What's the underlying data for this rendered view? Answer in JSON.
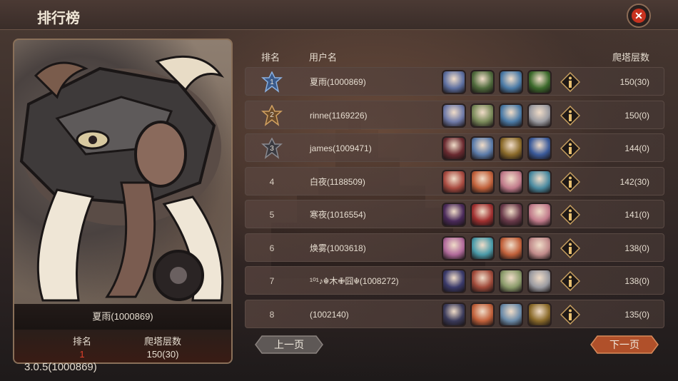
{
  "header": {
    "title": "排行榜"
  },
  "selected": {
    "name": "夏雨(1000869)",
    "rank_label": "排名",
    "rank_value": "1",
    "floor_label": "爬塔层数",
    "floor_value": "150(30)"
  },
  "version": "3.0.5(1000869)",
  "table": {
    "headers": {
      "rank": "排名",
      "user": "用户名",
      "floor": "爬塔层数"
    },
    "rows": [
      {
        "rank": "1",
        "name": "夏雨(1000869)",
        "floor": "150(30)",
        "badge": "blue-star",
        "heroes": [
          "#5d6fa0",
          "#4f6a3c",
          "#4a7aa6",
          "#3c6a2c"
        ]
      },
      {
        "rank": "2",
        "name": "rinne(1169226)",
        "floor": "150(0)",
        "badge": "bronze-star",
        "heroes": [
          "#6f7aa8",
          "#7a8a5a",
          "#4a7aa6",
          "#9a9aa0"
        ]
      },
      {
        "rank": "3",
        "name": "james(1009471)",
        "floor": "144(0)",
        "badge": "dark-star",
        "heroes": [
          "#6a2a30",
          "#5a7aa8",
          "#8a6a2a",
          "#3a5a9a"
        ]
      },
      {
        "rank": "4",
        "name": "白夜(1188509)",
        "floor": "142(30)",
        "badge": "",
        "heroes": [
          "#a84a40",
          "#c0603a",
          "#c07a8a",
          "#4a8aa0"
        ]
      },
      {
        "rank": "5",
        "name": "寒夜(1016554)",
        "floor": "141(0)",
        "badge": "",
        "heroes": [
          "#4a2a5a",
          "#a03030",
          "#6a3a4a",
          "#c07a8a"
        ]
      },
      {
        "rank": "6",
        "name": "焕雾(1003618)",
        "floor": "138(0)",
        "badge": "",
        "heroes": [
          "#b06a9a",
          "#4a9aa8",
          "#c0603a",
          "#c08a8a"
        ]
      },
      {
        "rank": "7",
        "name": "¹⁰¹♪☬木✙囧☬(1008272)",
        "floor": "138(0)",
        "badge": "",
        "heroes": [
          "#3a3a6a",
          "#a04a3a",
          "#8a9a6a",
          "#9a9aa0"
        ]
      },
      {
        "rank": "8",
        "name": "(1002140)",
        "floor": "135(0)",
        "badge": "",
        "heroes": [
          "#3a3a5a",
          "#c0603a",
          "#6a8aa8",
          "#8a6a2a"
        ]
      }
    ]
  },
  "pager": {
    "prev": "上一页",
    "next": "下一页"
  },
  "colors": {
    "accent_red": "#e0402a",
    "close_red": "#c8321f",
    "next_orange": "#b8542c",
    "prev_gray": "#6a6260"
  }
}
